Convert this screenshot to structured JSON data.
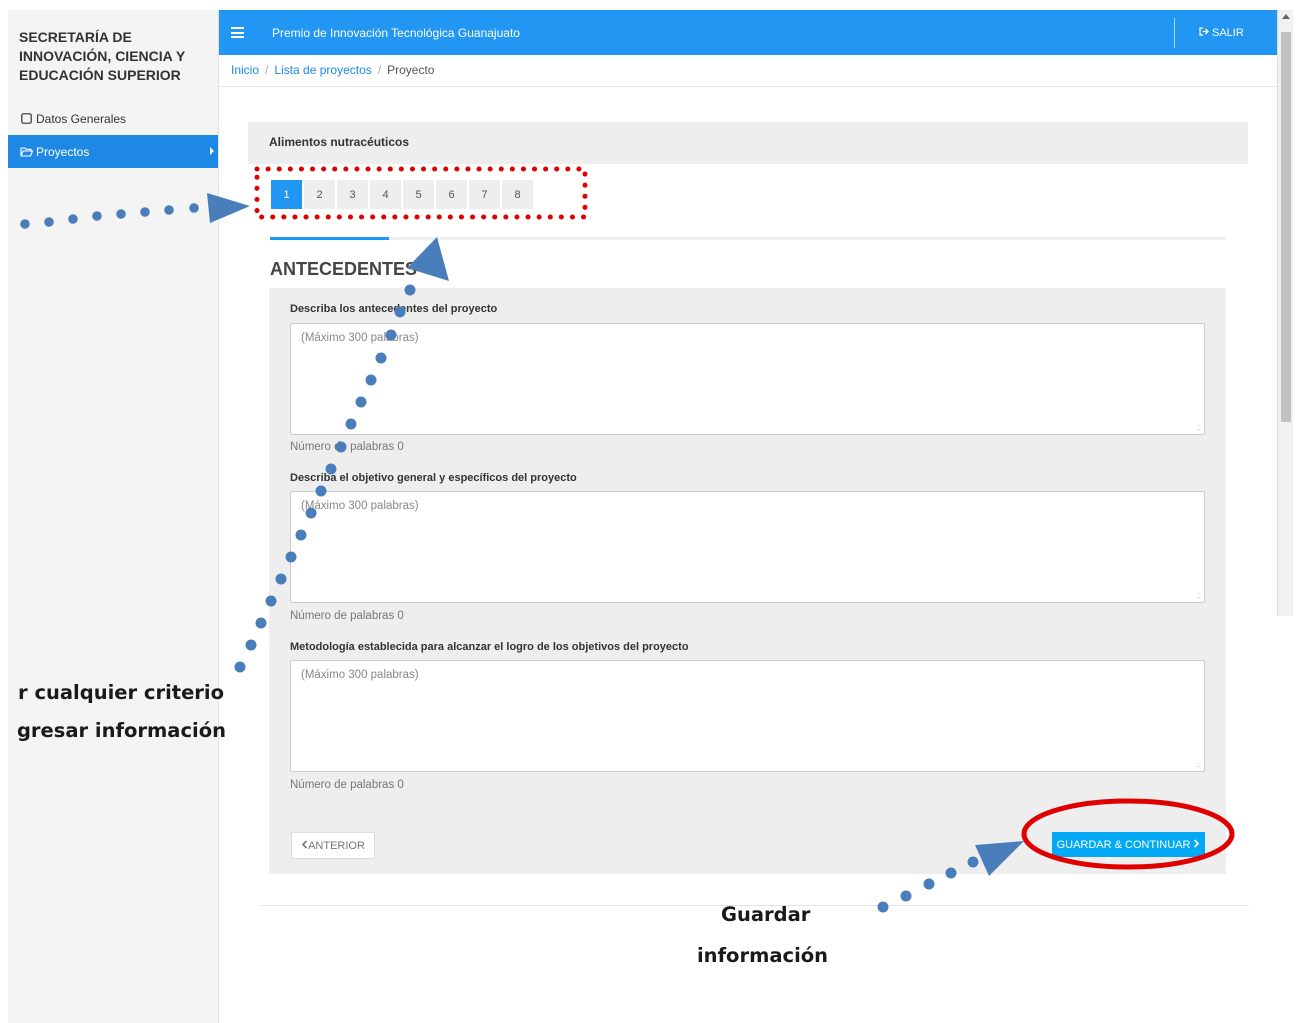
{
  "sidebar": {
    "title": "SECRETARÍA DE INNOVACIÓN, CIENCIA Y EDUCACIÓN SUPERIOR",
    "items": [
      {
        "label": "Datos Generales",
        "icon": "square-outline-icon"
      },
      {
        "label": "Proyectos",
        "icon": "folder-open-icon",
        "active": true
      }
    ]
  },
  "header": {
    "title": "Premio de Innovación Tecnológica Guanajuato",
    "logout_label": "SALIR"
  },
  "breadcrumb": [
    "Inicio",
    "Lista de proyectos",
    "Proyecto"
  ],
  "project": {
    "title": "Alimentos nutracéuticos",
    "steps": [
      "1",
      "2",
      "3",
      "4",
      "5",
      "6",
      "7",
      "8"
    ],
    "active_step": "1",
    "section_title": "ANTECEDENTES"
  },
  "questions": [
    {
      "label": "Describa los antecedentes del proyecto",
      "placeholder": "(Máximo 300 palabras)",
      "word_count": "Número de palabras 0"
    },
    {
      "label": "Describa el objetivo general y específicos del proyecto",
      "placeholder": "(Máximo 300 palabras)",
      "word_count": "Número de palabras 0"
    },
    {
      "label": "Metodología establecida para alcanzar el logro de los objetivos del proyecto",
      "placeholder": "(Máximo 300 palabras)",
      "word_count": "Número de palabras 0"
    }
  ],
  "buttons": {
    "previous": "ANTERIOR",
    "save_continue": "GUARDAR & CONTINUAR"
  },
  "annotations": {
    "left_line1": "r cualquier criterio",
    "left_line2": "gresar información",
    "bottom_line1": "Guardar",
    "bottom_line2": "información"
  },
  "colors": {
    "primary": "#2196f3",
    "save_button": "#03a9f4",
    "annotation_dots": "#4a7ebb",
    "highlight_red": "#e00000"
  }
}
